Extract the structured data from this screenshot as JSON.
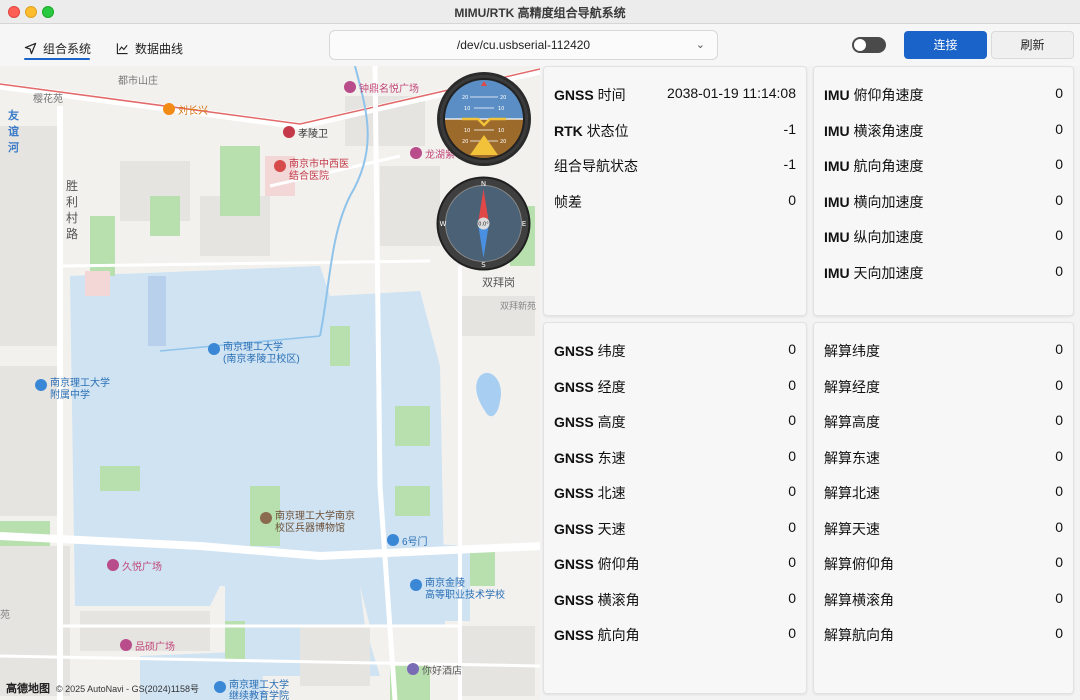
{
  "window": {
    "title": "MIMU/RTK 高精度组合导航系统"
  },
  "toolbar": {
    "tabs": [
      {
        "label": "组合系统",
        "icon": "navigation-arrow-icon",
        "active": true
      },
      {
        "label": "数据曲线",
        "icon": "line-chart-icon",
        "active": false
      }
    ],
    "port": {
      "selected": "/dev/cu.usbserial-112420"
    },
    "toggle_on": false,
    "connect_label": "连接",
    "refresh_label": "刷新",
    "accent": "#1a63c9"
  },
  "map": {
    "pois": {
      "zhongding": "钟鼎名悦广场",
      "liuchangxing": "刘长兴",
      "xiaolingwei": "孝陵卫",
      "hospital_1": "南京市中西医",
      "hospital_2": "结合医院",
      "longhu": "龙湖紫",
      "njust_1": "南京理工大学",
      "njust_2": "(南京孝陵卫校区)",
      "affiliated_1": "南京理工大学",
      "affiliated_2": "附属中学",
      "museum_1": "南京理工大学南京",
      "museum_2": "校区兵器博物馆",
      "gate6": "6号门",
      "jiuyue": "久悦广场",
      "jinling_1": "南京金陵",
      "jinling_2": "高等职业技术学校",
      "pinshuo": "品硕广场",
      "njust_cont_1": "南京理工大学",
      "njust_cont_2": "继续教育学院",
      "nihao": "你好酒店"
    },
    "labels": {
      "dushishanzhuang": "都市山庄",
      "yinghuayuan": "樱花苑",
      "youyi_river": "友谊河",
      "shenglicun_road": "胜利村路",
      "shuangbaigang": "双拜岗",
      "shuangbai_new": "双拜新苑",
      "yuan": "苑"
    },
    "footer": {
      "logo": "高德地图",
      "copyright": "© 2025 AutoNavi - GS(2024)1158号"
    },
    "compass": {
      "heading_label": "0.0°",
      "n": "N",
      "s": "S",
      "e": "E",
      "w": "W"
    },
    "attitude_scale": [
      "10",
      "20",
      "30"
    ]
  },
  "panels": {
    "status": [
      {
        "key_bold": "GNSS",
        "key": " 时间",
        "value": "2038-01-19 11:14:08"
      },
      {
        "key_bold": "RTK",
        "key": " 状态位",
        "value": "-1"
      },
      {
        "key_bold": "",
        "key": "组合导航状态",
        "value": "-1"
      },
      {
        "key_bold": "",
        "key": "帧差",
        "value": "0"
      }
    ],
    "imu": [
      {
        "key_bold": "IMU",
        "key": " 俯仰角速度",
        "value": "0"
      },
      {
        "key_bold": "IMU",
        "key": " 横滚角速度",
        "value": "0"
      },
      {
        "key_bold": "IMU",
        "key": " 航向角速度",
        "value": "0"
      },
      {
        "key_bold": "IMU",
        "key": " 横向加速度",
        "value": "0"
      },
      {
        "key_bold": "IMU",
        "key": " 纵向加速度",
        "value": "0"
      },
      {
        "key_bold": "IMU",
        "key": " 天向加速度",
        "value": "0"
      }
    ],
    "gnss": [
      {
        "key_bold": "GNSS",
        "key": " 纬度",
        "value": "0"
      },
      {
        "key_bold": "GNSS",
        "key": " 经度",
        "value": "0"
      },
      {
        "key_bold": "GNSS",
        "key": " 高度",
        "value": "0"
      },
      {
        "key_bold": "GNSS",
        "key": " 东速",
        "value": "0"
      },
      {
        "key_bold": "GNSS",
        "key": " 北速",
        "value": "0"
      },
      {
        "key_bold": "GNSS",
        "key": " 天速",
        "value": "0"
      },
      {
        "key_bold": "GNSS",
        "key": " 俯仰角",
        "value": "0"
      },
      {
        "key_bold": "GNSS",
        "key": " 横滚角",
        "value": "0"
      },
      {
        "key_bold": "GNSS",
        "key": " 航向角",
        "value": "0"
      }
    ],
    "solution": [
      {
        "key_bold": "",
        "key": "解算纬度",
        "value": "0"
      },
      {
        "key_bold": "",
        "key": "解算经度",
        "value": "0"
      },
      {
        "key_bold": "",
        "key": "解算高度",
        "value": "0"
      },
      {
        "key_bold": "",
        "key": "解算东速",
        "value": "0"
      },
      {
        "key_bold": "",
        "key": "解算北速",
        "value": "0"
      },
      {
        "key_bold": "",
        "key": "解算天速",
        "value": "0"
      },
      {
        "key_bold": "",
        "key": "解算俯仰角",
        "value": "0"
      },
      {
        "key_bold": "",
        "key": "解算横滚角",
        "value": "0"
      },
      {
        "key_bold": "",
        "key": "解算航向角",
        "value": "0"
      }
    ]
  }
}
